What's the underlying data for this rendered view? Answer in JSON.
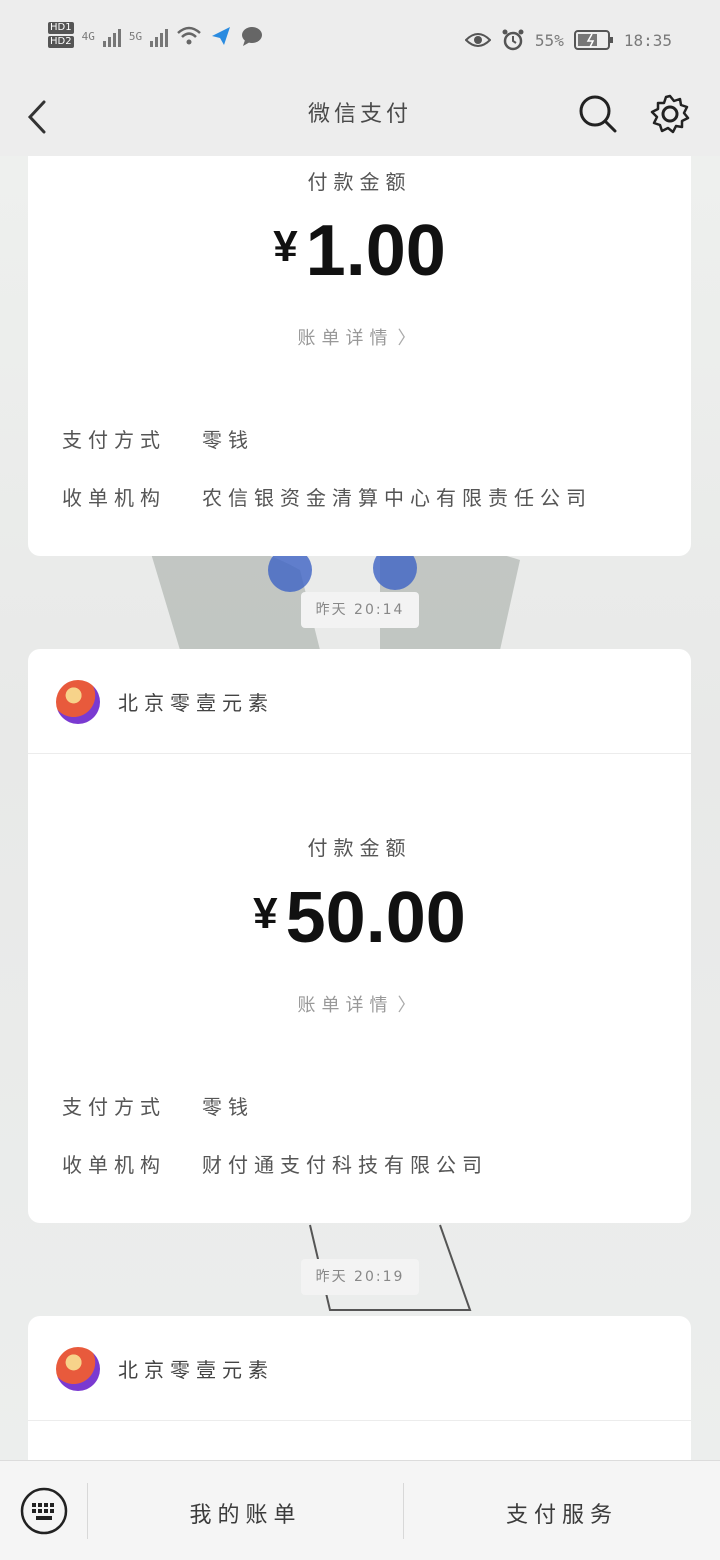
{
  "status_bar": {
    "network_left": "4G",
    "network_right": "5G",
    "battery_percent": "55%",
    "time": "18:35"
  },
  "nav": {
    "title": "微信支付"
  },
  "cards": [
    {
      "amount_label": "付款金额",
      "currency": "¥",
      "amount": "1.00",
      "detail_link": "账单详情",
      "payment_method_label": "支付方式",
      "payment_method": "零钱",
      "institution_label": "收单机构",
      "institution": "农信银资金清算中心有限责任公司"
    },
    {
      "merchant": "北京零壹元素",
      "amount_label": "付款金额",
      "currency": "¥",
      "amount": "50.00",
      "detail_link": "账单详情",
      "payment_method_label": "支付方式",
      "payment_method": "零钱",
      "institution_label": "收单机构",
      "institution": "财付通支付科技有限公司"
    },
    {
      "merchant": "北京零壹元素"
    }
  ],
  "timestamps": [
    "昨天 20:14",
    "昨天 20:19"
  ],
  "bottom_bar": {
    "my_bills": "我的账单",
    "pay_services": "支付服务"
  }
}
